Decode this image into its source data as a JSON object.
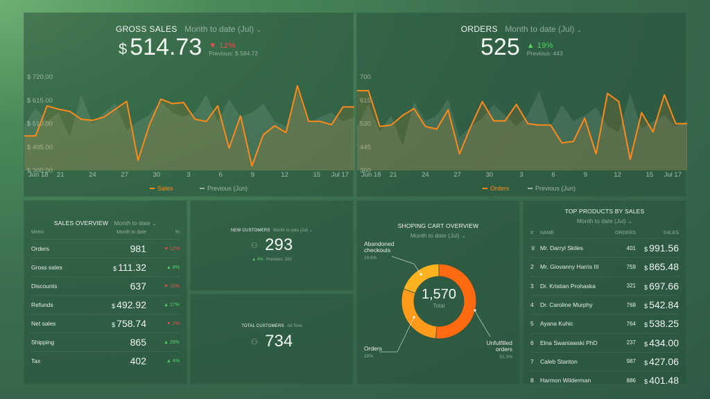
{
  "gross_sales": {
    "title": "GROSS SALES",
    "period": "Month to date (Jul)",
    "currency": "$",
    "value": "514.73",
    "change": "12%",
    "change_dir": "down",
    "previous": "Previous: $ 584.72",
    "legend_current": "Sales",
    "legend_previous": "Previous (Jun)"
  },
  "orders": {
    "title": "ORDERS",
    "period": "Month to date (Jul)",
    "value": "525",
    "change": "19%",
    "change_dir": "up",
    "previous": "Previous: 443",
    "legend_current": "Orders",
    "legend_previous": "Previous (Jun)"
  },
  "sales_overview": {
    "title": "SALES OVERVIEW",
    "period": "Month to date",
    "col_metric": "Metric",
    "col_value": "Month to date",
    "col_pct": "%",
    "rows": [
      {
        "metric": "Orders",
        "cur": "",
        "value": "981",
        "pct": "12%",
        "dir": "down"
      },
      {
        "metric": "Gross sales",
        "cur": "$",
        "value": "111.32",
        "pct": "8%",
        "dir": "up"
      },
      {
        "metric": "Discounts",
        "cur": "",
        "value": "637",
        "pct": "16%",
        "dir": "down"
      },
      {
        "metric": "Refunds",
        "cur": "$",
        "value": "492.92",
        "pct": "17%",
        "dir": "up"
      },
      {
        "metric": "Net sales",
        "cur": "$",
        "value": "758.74",
        "pct": "2%",
        "dir": "down"
      },
      {
        "metric": "Shipping",
        "cur": "",
        "value": "865",
        "pct": "25%",
        "dir": "up"
      },
      {
        "metric": "Tax",
        "cur": "",
        "value": "402",
        "pct": "4%",
        "dir": "up"
      }
    ]
  },
  "new_customers": {
    "title": "NEW CUSTOMERS",
    "period": "Month to date (Jul)",
    "value": "293",
    "change": "4%",
    "previous": "Previous: 282"
  },
  "total_customers": {
    "title": "TOTAL CUSTOMERS",
    "period": "All Time",
    "value": "734"
  },
  "cart": {
    "title": "SHOPING CART OVERVIEW",
    "period": "Month to date (Jul)",
    "total": "1,570",
    "total_label": "Total",
    "abandoned_l1": "Abandoned",
    "abandoned_l2": "checkouts",
    "abandoned_pct": "19.6%",
    "orders_label": "Orders",
    "orders_pct": "29%",
    "unfulfilled_l1": "Unfulfilled",
    "unfulfilled_l2": "orders",
    "unfulfilled_pct": "51.3%",
    "colors": {
      "unfulfilled": "#ff6a10",
      "orders": "#ff9a1a",
      "abandoned": "#ffb21f"
    }
  },
  "top_products": {
    "title": "TOP PRODUCTS BY SALES",
    "period": "Month to date (Jul)",
    "col_num": "#",
    "col_name": "NAME",
    "col_orders": "ORDERS",
    "col_sales": "SALES",
    "rows": [
      {
        "num": "♕",
        "name": "Mr. Darryl Skiles",
        "orders": "401",
        "sales": "991.56"
      },
      {
        "num": "2",
        "name": "Mr. Giovanny Harris III",
        "orders": "759",
        "sales": "865.48"
      },
      {
        "num": "3",
        "name": "Dr. Kristian Prohaska",
        "orders": "321",
        "sales": "697.66"
      },
      {
        "num": "4",
        "name": "Dr. Caroline Murphy",
        "orders": "768",
        "sales": "542.84"
      },
      {
        "num": "5",
        "name": "Ayana Kuhic",
        "orders": "764",
        "sales": "538.25"
      },
      {
        "num": "6",
        "name": "Elna Swaniawski PhD",
        "orders": "237",
        "sales": "434.00"
      },
      {
        "num": "7",
        "name": "Caleb Stanton",
        "orders": "987",
        "sales": "427.06"
      },
      {
        "num": "8",
        "name": "Harmon Wilderman",
        "orders": "886",
        "sales": "401.48"
      }
    ]
  },
  "chart_data": [
    {
      "type": "line",
      "ylim": [
        300,
        720
      ],
      "yticks": [
        "$ 720.00",
        "$ 615.00",
        "$ 510.00",
        "$ 405.00",
        "$ 300.00"
      ],
      "xticks": [
        "Jun 18",
        "21",
        "24",
        "27",
        "30",
        "3",
        "6",
        "9",
        "12",
        "15",
        "Jul 17"
      ],
      "x": [
        "Jun 18",
        "Jun 19",
        "Jun 20",
        "Jun 21",
        "Jun 22",
        "Jun 23",
        "Jun 24",
        "Jun 25",
        "Jun 26",
        "Jun 27",
        "Jun 28",
        "Jun 29",
        "Jun 30",
        "Jul 1",
        "Jul 2",
        "Jul 3",
        "Jul 4",
        "Jul 5",
        "Jul 6",
        "Jul 7",
        "Jul 8",
        "Jul 9",
        "Jul 10",
        "Jul 11",
        "Jul 12",
        "Jul 13",
        "Jul 14",
        "Jul 15",
        "Jul 16",
        "Jul 17"
      ],
      "series": [
        {
          "name": "Sales",
          "color": "#ff8a1a",
          "values": [
            455,
            455,
            590,
            575,
            565,
            530,
            525,
            540,
            575,
            610,
            345,
            505,
            620,
            600,
            605,
            530,
            520,
            590,
            400,
            545,
            320,
            460,
            500,
            470,
            680,
            520,
            520,
            505,
            585,
            585
          ]
        },
        {
          "name": "Previous (Jun)",
          "color": "#9fb3a5",
          "values": [
            505,
            580,
            520,
            560,
            450,
            640,
            510,
            560,
            600,
            480,
            520,
            550,
            610,
            560,
            540,
            560,
            640,
            520,
            620,
            540,
            560,
            600,
            520,
            500,
            660,
            510,
            540,
            560,
            520,
            540
          ]
        }
      ]
    },
    {
      "type": "line",
      "ylim": [
        360,
        700
      ],
      "yticks": [
        "700",
        "615",
        "530",
        "445",
        "360"
      ],
      "xticks": [
        "Jun 18",
        "21",
        "24",
        "27",
        "30",
        "3",
        "6",
        "9",
        "12",
        "15",
        "Jul 17"
      ],
      "x": [
        "Jun 18",
        "Jun 19",
        "Jun 20",
        "Jun 21",
        "Jun 22",
        "Jun 23",
        "Jun 24",
        "Jun 25",
        "Jun 26",
        "Jun 27",
        "Jun 28",
        "Jun 29",
        "Jun 30",
        "Jul 1",
        "Jul 2",
        "Jul 3",
        "Jul 4",
        "Jul 5",
        "Jul 6",
        "Jul 7",
        "Jul 8",
        "Jul 9",
        "Jul 10",
        "Jul 11",
        "Jul 12",
        "Jul 13",
        "Jul 14",
        "Jul 15",
        "Jul 16",
        "Jul 17"
      ],
      "series": [
        {
          "name": "Orders",
          "color": "#ff8a1a",
          "values": [
            650,
            650,
            520,
            525,
            560,
            585,
            520,
            510,
            580,
            420,
            520,
            610,
            540,
            540,
            600,
            530,
            525,
            525,
            460,
            465,
            550,
            420,
            640,
            610,
            400,
            570,
            500,
            635,
            530,
            530
          ]
        },
        {
          "name": "Previous (Jun)",
          "color": "#9fb3a5",
          "values": [
            520,
            600,
            500,
            560,
            450,
            610,
            540,
            560,
            620,
            480,
            520,
            550,
            600,
            560,
            520,
            560,
            650,
            520,
            600,
            540,
            560,
            590,
            520,
            500,
            640,
            510,
            540,
            560,
            520,
            540
          ]
        }
      ]
    },
    {
      "type": "pie",
      "categories": [
        "Unfulfilled orders",
        "Orders",
        "Abandoned checkouts"
      ],
      "values": [
        51.3,
        29,
        19.6
      ]
    }
  ]
}
